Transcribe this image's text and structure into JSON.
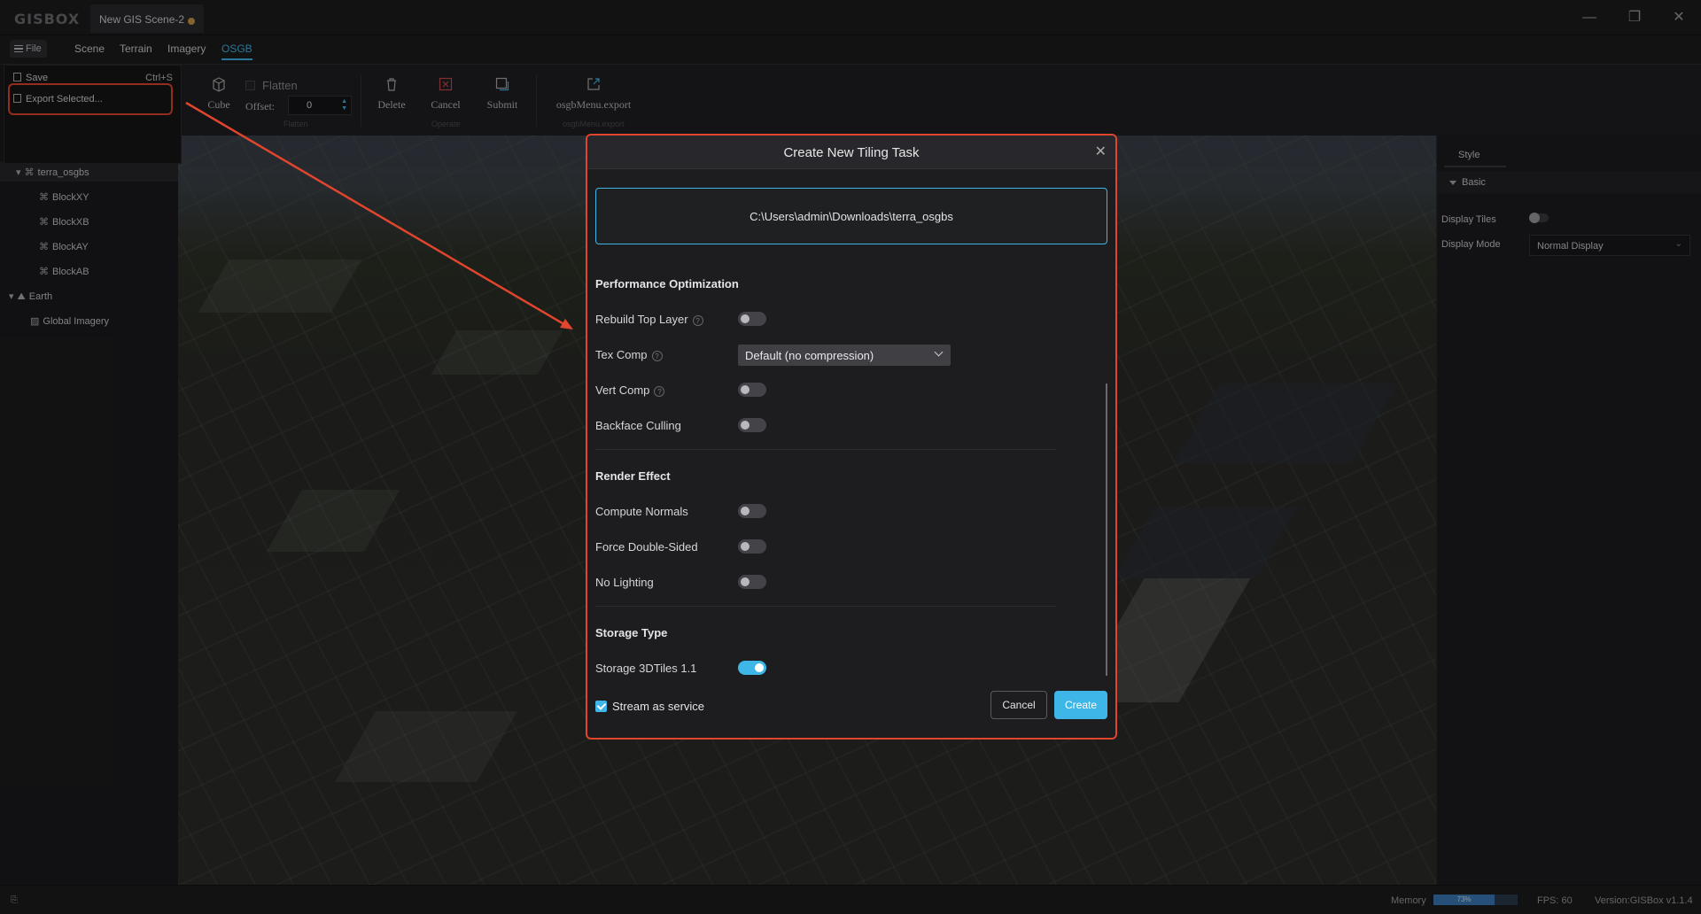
{
  "app": {
    "logo": "GISBOX",
    "doc_tab": "New GIS Scene-2"
  },
  "window_controls": {
    "minimize": "—",
    "restore": "❐",
    "close": "✕"
  },
  "menubar": {
    "file": "File",
    "items": [
      "Scene",
      "Terrain",
      "Imagery",
      "OSGB"
    ],
    "active": "OSGB"
  },
  "file_menu": {
    "save": "Save",
    "save_shortcut": "Ctrl+S",
    "export": "Export Selected..."
  },
  "toolbar": {
    "cube": "Cube",
    "flatten": "Flatten",
    "offset_label": "Offset:",
    "offset_value": "0",
    "flatten_group": "Flatten",
    "delete": "Delete",
    "cancel": "Cancel",
    "submit": "Submit",
    "operate_group": "Operate",
    "export": "osgbMenu.export",
    "export_group": "osgbMenu.export"
  },
  "tree": {
    "items": [
      {
        "label": "terra_osgbs",
        "level": 1,
        "selected": true
      },
      {
        "label": "BlockXY",
        "level": 2
      },
      {
        "label": "BlockXB",
        "level": 2
      },
      {
        "label": "BlockAY",
        "level": 2
      },
      {
        "label": "BlockAB",
        "level": 2
      },
      {
        "label": "Earth",
        "level": 0
      },
      {
        "label": "Global Imagery",
        "level": 1
      }
    ]
  },
  "right_panel": {
    "tab": "Style",
    "section": "Basic",
    "display_tiles_label": "Display Tiles",
    "display_mode_label": "Display Mode",
    "display_mode_value": "Normal Display"
  },
  "statusbar": {
    "memory_label": "Memory",
    "memory_value": "73%",
    "memory_fraction": 0.73,
    "fps": "FPS: 60",
    "version": "Version:GISBox v1.1.4"
  },
  "modal": {
    "title": "Create New Tiling Task",
    "path": "C:\\Users\\admin\\Downloads\\terra_osgbs",
    "perf_heading": "Performance Optimization",
    "rebuild_top_layer": "Rebuild Top Layer",
    "tex_comp": "Tex Comp",
    "tex_comp_value": "Default (no compression)",
    "vert_comp": "Vert Comp",
    "backface_culling": "Backface Culling",
    "render_heading": "Render Effect",
    "compute_normals": "Compute Normals",
    "force_double_sided": "Force Double-Sided",
    "no_lighting": "No Lighting",
    "storage_heading": "Storage Type",
    "storage_3dtiles": "Storage 3DTiles 1.1",
    "stream_as_service": "Stream as service",
    "cancel": "Cancel",
    "create": "Create",
    "toggles": {
      "rebuild_top_layer": false,
      "vert_comp": false,
      "backface_culling": false,
      "compute_normals": false,
      "force_double_sided": false,
      "no_lighting": false,
      "storage_3dtiles": true,
      "stream_as_service": true
    }
  },
  "colors": {
    "accent": "#3fb6e8",
    "highlight_red": "#e0452e",
    "tab_dot": "#c89a4a"
  }
}
